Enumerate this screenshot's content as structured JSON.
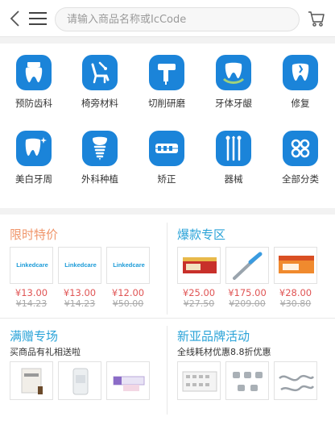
{
  "header": {
    "search_placeholder": "请输入商品名称或IcCode",
    "icons": [
      "back-chevron",
      "menu-hamburger",
      "shopping-cart"
    ]
  },
  "categories": [
    {
      "label": "预防齿科",
      "icon": "tooth-brush-icon"
    },
    {
      "label": "椅旁材料",
      "icon": "dental-chair-icon"
    },
    {
      "label": "切削研磨",
      "icon": "drill-icon"
    },
    {
      "label": "牙体牙龈",
      "icon": "tooth-gum-icon"
    },
    {
      "label": "修复",
      "icon": "tooth-repair-icon"
    },
    {
      "label": "美白牙周",
      "icon": "tooth-sparkle-icon"
    },
    {
      "label": "外科种植",
      "icon": "implant-icon"
    },
    {
      "label": "矫正",
      "icon": "braces-icon"
    },
    {
      "label": "器械",
      "icon": "instruments-icon"
    },
    {
      "label": "全部分类",
      "icon": "all-categories-icon"
    }
  ],
  "promo": {
    "limited": {
      "title": "限时特价",
      "title_color": "#f0956a",
      "items": [
        {
          "brand": "Linkedcare",
          "price": "¥13.00",
          "orig": "¥14.23"
        },
        {
          "brand": "Linkedcare",
          "price": "¥13.00",
          "orig": "¥14.23"
        },
        {
          "brand": "Linkedcare",
          "price": "¥12.00",
          "orig": "¥50.00"
        }
      ]
    },
    "hot": {
      "title": "爆款专区",
      "title_color": "#2aa3d8",
      "items": [
        {
          "price": "¥25.00",
          "orig": "¥27.50"
        },
        {
          "price": "¥175.00",
          "orig": "¥209.00"
        },
        {
          "price": "¥28.00",
          "orig": "¥30.80"
        }
      ]
    },
    "gift": {
      "title": "满赠专场",
      "subtitle": "买商品有礼相送啦",
      "title_color": "#2aa3d8"
    },
    "newbrand": {
      "title": "新亚品牌活动",
      "subtitle": "全线耗材优惠8.8折优惠",
      "title_color": "#2aa3d8"
    }
  },
  "colors": {
    "accent": "#1b84d9",
    "price": "#e05454"
  }
}
